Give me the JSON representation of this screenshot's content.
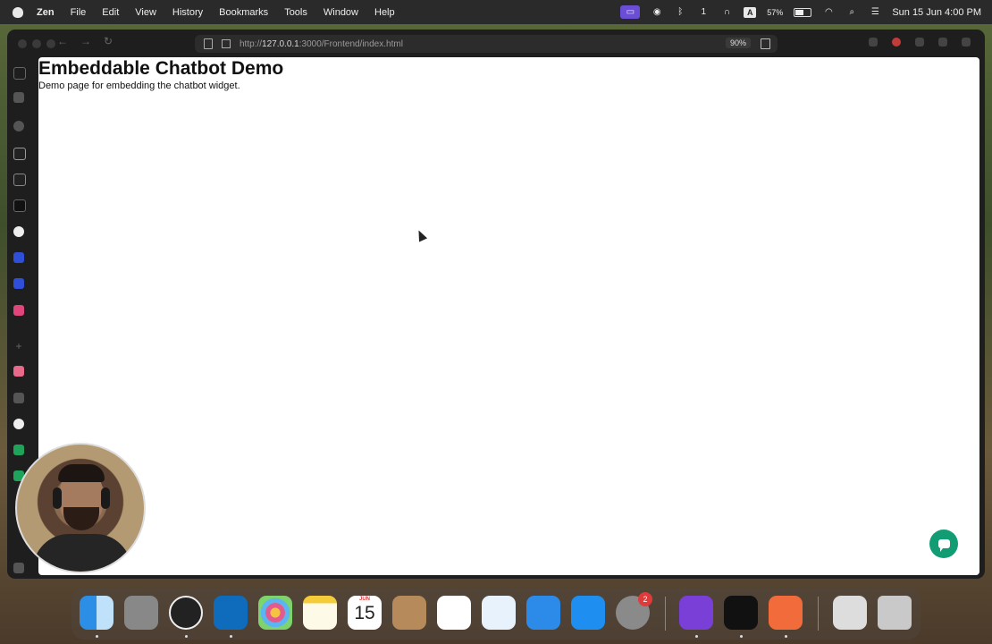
{
  "menubar": {
    "app_name": "Zen",
    "items": [
      "File",
      "Edit",
      "View",
      "History",
      "Bookmarks",
      "Tools",
      "Window",
      "Help"
    ],
    "status": {
      "notification_count": "1",
      "input_source": "A",
      "battery": "57%",
      "battery_level": 0.57,
      "datetime": "Sun 15 Jun  4:00 PM"
    }
  },
  "browser": {
    "url_prefix": "http://",
    "url_host": "127.0.0.1",
    "url_rest": ":3000/Frontend/index.html",
    "zoom": "90%"
  },
  "page": {
    "title": "Embeddable Chatbot Demo",
    "subtitle": "Demo page for embedding the chatbot widget."
  },
  "dock": {
    "calendar_month": "JUN",
    "calendar_day": "15",
    "settings_badge": "2"
  },
  "colors": {
    "chat_launcher": "#119c74",
    "accent_purple": "#6a4fd6",
    "badge_red": "#e03b3b"
  }
}
